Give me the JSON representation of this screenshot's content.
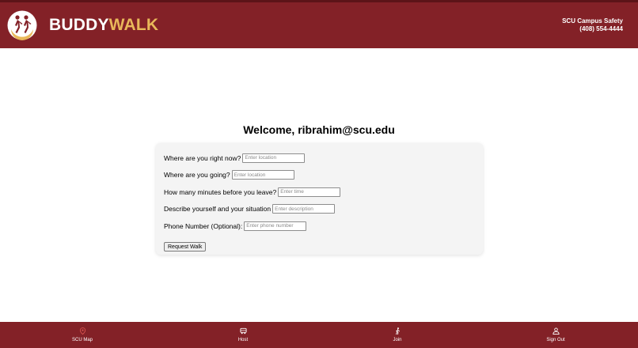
{
  "header": {
    "brand_part1": "BUDDY",
    "brand_part2": "WALK",
    "safety_line1": "SCU Campus Safety",
    "safety_line2": "(408) 554-4444"
  },
  "main": {
    "welcome": "Welcome, ribrahim@scu.edu"
  },
  "form": {
    "fields": [
      {
        "label": "Where are you right now?",
        "placeholder": "Enter location",
        "value": ""
      },
      {
        "label": "Where are you going?",
        "placeholder": "Enter location",
        "value": ""
      },
      {
        "label": "How many minutes before you leave?",
        "placeholder": "Enter time",
        "value": ""
      },
      {
        "label": "Describe yourself and your situation",
        "placeholder": "Enter description",
        "value": ""
      },
      {
        "label": "Phone Number (Optional):",
        "placeholder": "Enter phone number",
        "value": ""
      }
    ],
    "submit_label": "Request Walk"
  },
  "footer": {
    "items": [
      {
        "label": "SCU Map",
        "icon": "map-pin-icon"
      },
      {
        "label": "Host",
        "icon": "car-icon"
      },
      {
        "label": "Join",
        "icon": "walking-person-icon"
      },
      {
        "label": "Sign Out",
        "icon": "user-icon"
      }
    ]
  },
  "colors": {
    "brand_red": "#832127",
    "brand_gold": "#e9b85a",
    "map_icon": "#d9534f"
  }
}
